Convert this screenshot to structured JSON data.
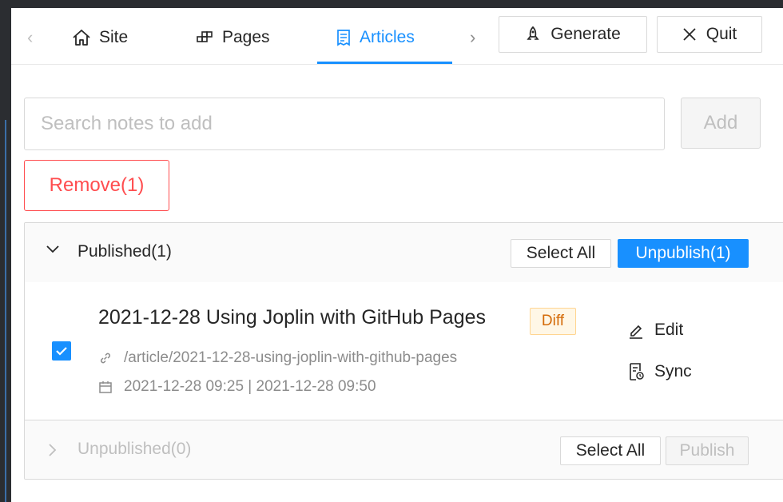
{
  "tabs": {
    "items": [
      {
        "label": "Site",
        "icon": "home-icon",
        "active": false
      },
      {
        "label": "Pages",
        "icon": "pages-icon",
        "active": false
      },
      {
        "label": "Articles",
        "icon": "articles-icon",
        "active": true
      }
    ],
    "generate_label": "Generate",
    "quit_label": "Quit"
  },
  "search": {
    "placeholder": "Search notes to add",
    "value": ""
  },
  "add_label": "Add",
  "remove_label": "Remove(1)",
  "published": {
    "title": "Published(1)",
    "select_all_label": "Select All",
    "unpublish_label": "Unpublish(1)",
    "articles": [
      {
        "title": "2021-12-28 Using Joplin with GitHub Pages",
        "badge": "Diff",
        "url": "/article/2021-12-28-using-joplin-with-github-pages",
        "dates": "2021-12-28 09:25 | 2021-12-28 09:50",
        "checked": true,
        "edit_label": "Edit",
        "sync_label": "Sync"
      }
    ]
  },
  "unpublished": {
    "title": "Unpublished(0)",
    "select_all_label": "Select All",
    "publish_label": "Publish"
  },
  "colors": {
    "primary": "#1890ff",
    "danger": "#ff4d4f",
    "warning": "#d46b08"
  }
}
